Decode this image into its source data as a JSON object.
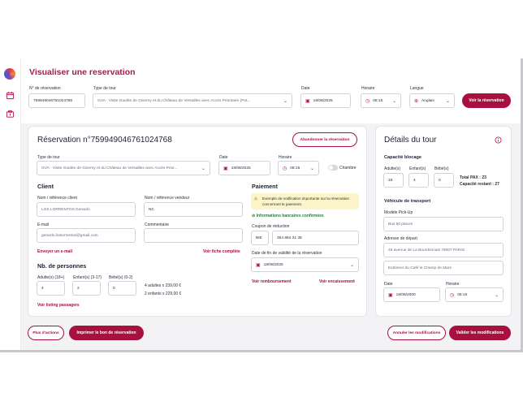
{
  "page": {
    "title": "Visualiser une reservation"
  },
  "search": {
    "reservation_label": "N° de réservation",
    "reservation_value": "759949046761024768",
    "tour_type_label": "Type de tour",
    "tour_type_value": "GVA - Visite Guidée de Giverny et du Château de Versailles avec Accès Prioritaire (Pet...",
    "date_label": "Date",
    "date_value": "18/08/2025",
    "time_label": "Horaire",
    "time_value": "08:15",
    "language_label": "Langue",
    "language_value": "Anglais",
    "view_button": "Voir la réservation"
  },
  "reservation": {
    "title": "Réservation n°759949046761024768",
    "abandon_button": "Abandonner la réservation",
    "tour_type_label": "Type de tour",
    "tour_type_value": "GVA - Visite Guidée de Giverny et du Château de Versailles avec Accès Prior...",
    "date_label": "Date",
    "date_value": "18/08/2025",
    "time_label": "Horaire",
    "time_value": "08:15",
    "room_label": "Chambre",
    "client_title": "Client",
    "client_name_label": "Nom / référence client",
    "client_name_value": "LOS LORRENTOS Gerardo",
    "vendor_label": "Nom / référence vendeur",
    "vendor_value": "NC",
    "email_label": "E-mail",
    "email_value": "gerardo.lostorrentos@gmail.com",
    "comment_label": "Commentaire",
    "send_email_link": "Envoyer un e-mail",
    "view_file_link": "Voir fiche complète",
    "people_title": "Nb. de personnes",
    "adults_label": "Adulte(s) (18+)",
    "adults_value": "4",
    "children_label": "Enfant(s) (3-17)",
    "children_value": "2",
    "babies_label": "Bébé(s) (0-2)",
    "babies_value": "0",
    "adults_price": "4 adultes x 239,00 €",
    "children_price": "2 enfants x 229,00 €",
    "passengers_link": "Voir listing passagers",
    "payment_title": "Paiement",
    "notice": "Exemple de notification importante sur la réservation concernant le paiement.",
    "bank_confirmed": "Informations bancaires confirmées",
    "coupon_label": "Coupon de réduction",
    "coupon_prefix": "BIE",
    "coupon_value": "354 864 31 35",
    "validity_label": "Date de fin de validité de la réservation",
    "validity_value": "18/08/2025",
    "refund_link": "Voir remboursement",
    "collect_link": "Voir encaissement"
  },
  "details": {
    "title": "Détails du tour",
    "capacity_title": "Capacité blocage",
    "adults_label": "Adulte(s)",
    "adults_value": "18",
    "children_label": "Enfant(s)",
    "children_value": "4",
    "babies_label": "Bébé(s)",
    "babies_value": "0",
    "total_pax": "Total PAX : 23",
    "remaining": "Capacité restant : 27",
    "vehicle_title": "Véhicule de transport",
    "model_label": "Modèle Pick-Up",
    "model_value": "Bus 50 places",
    "address_label": "Adresse de départ",
    "address_value": "45 avenue de La Bourdonnais 75007 PARIS",
    "address_extra": "Extérieur du Café le Champ de Mars",
    "date_label": "Date",
    "date_value": "18/08/2000",
    "time_label": "Horaire",
    "time_value": "08:15"
  },
  "footer": {
    "more_actions": "Plus d'actions",
    "print_button": "Imprimer le bon de réservation",
    "cancel_button": "Annuler les modifications",
    "save_button": "Valider les modifications"
  },
  "colors": {
    "accent": "#a8103f",
    "title": "#b0154c",
    "success": "#2d7a39",
    "notice_bg": "#fbf5c9"
  }
}
